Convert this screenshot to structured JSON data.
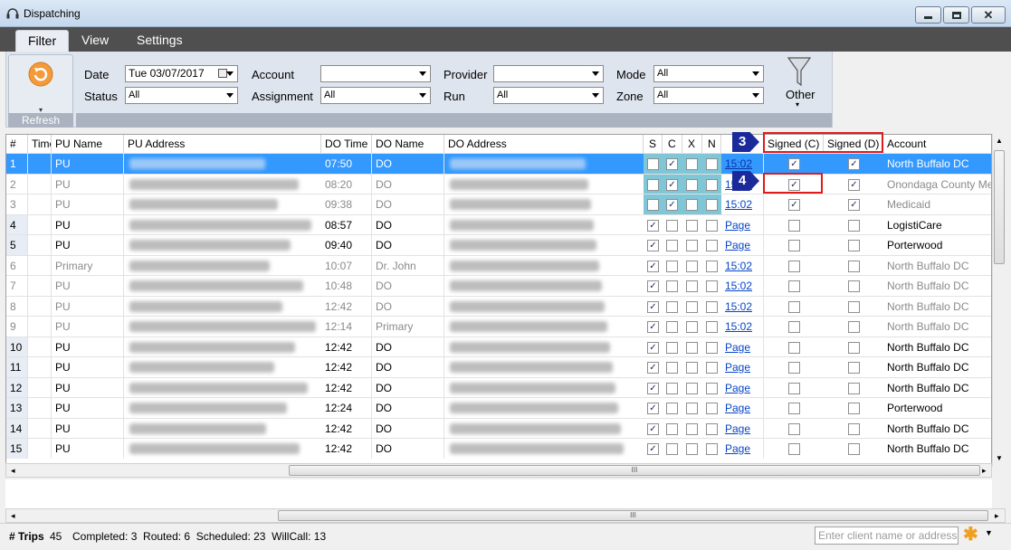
{
  "window": {
    "title": "Dispatching"
  },
  "menu": {
    "tabs": [
      "Filter",
      "View",
      "Settings"
    ]
  },
  "ribbon": {
    "refresh_label": "Refresh",
    "date_label": "Date",
    "date_value": "Tue 03/07/2017",
    "status_label": "Status",
    "status_value": "All",
    "account_label": "Account",
    "account_value": "",
    "assignment_label": "Assignment",
    "assignment_value": "All",
    "provider_label": "Provider",
    "provider_value": "",
    "run_label": "Run",
    "run_value": "All",
    "mode_label": "Mode",
    "mode_value": "All",
    "zone_label": "Zone",
    "zone_value": "All",
    "other_label": "Other"
  },
  "grid": {
    "headers": [
      "#",
      "Time",
      "PU Name",
      "PU Address",
      "DO Time",
      "DO Name",
      "DO Address",
      "S",
      "C",
      "X",
      "N",
      "",
      "Signed (C)",
      "Signed (D)",
      "Account"
    ],
    "rows": [
      {
        "num": "1",
        "pu": "PU",
        "do_time": "07:50",
        "do_name": "DO",
        "s": false,
        "c": true,
        "x": false,
        "n": false,
        "link": "15:02",
        "sc": true,
        "sd": true,
        "account": "North Buffalo DC",
        "muted": false,
        "selected": true,
        "signed_row": true
      },
      {
        "num": "2",
        "pu": "PU",
        "do_time": "08:20",
        "do_name": "DO",
        "s": false,
        "c": true,
        "x": false,
        "n": false,
        "link": "15:02",
        "sc": true,
        "sd": true,
        "account": "Onondaga County Medi",
        "muted": true,
        "selected": false,
        "signed_row": true
      },
      {
        "num": "3",
        "pu": "PU",
        "do_time": "09:38",
        "do_name": "DO",
        "s": false,
        "c": true,
        "x": false,
        "n": false,
        "link": "15:02",
        "sc": true,
        "sd": true,
        "account": "Medicaid",
        "muted": true,
        "selected": false,
        "signed_row": true
      },
      {
        "num": "4",
        "pu": "PU",
        "do_time": "08:57",
        "do_name": "DO",
        "s": true,
        "c": false,
        "x": false,
        "n": false,
        "link": "Page",
        "sc": false,
        "sd": false,
        "account": "LogistiCare",
        "muted": false,
        "selected": false,
        "signed_row": false
      },
      {
        "num": "5",
        "pu": "PU",
        "do_time": "09:40",
        "do_name": "DO",
        "s": true,
        "c": false,
        "x": false,
        "n": false,
        "link": "Page",
        "sc": false,
        "sd": false,
        "account": "Porterwood",
        "muted": false,
        "selected": false,
        "signed_row": false
      },
      {
        "num": "6",
        "pu": "Primary",
        "do_time": "10:07",
        "do_name": "Dr. John",
        "s": true,
        "c": false,
        "x": false,
        "n": false,
        "link": "15:02",
        "sc": false,
        "sd": false,
        "account": "North Buffalo DC",
        "muted": true,
        "selected": false,
        "signed_row": false
      },
      {
        "num": "7",
        "pu": "PU",
        "do_time": "10:48",
        "do_name": "DO",
        "s": true,
        "c": false,
        "x": false,
        "n": false,
        "link": "15:02",
        "sc": false,
        "sd": false,
        "account": "North Buffalo DC",
        "muted": true,
        "selected": false,
        "signed_row": false
      },
      {
        "num": "8",
        "pu": "PU",
        "do_time": "12:42",
        "do_name": "DO",
        "s": true,
        "c": false,
        "x": false,
        "n": false,
        "link": "15:02",
        "sc": false,
        "sd": false,
        "account": "North Buffalo DC",
        "muted": true,
        "selected": false,
        "signed_row": false
      },
      {
        "num": "9",
        "pu": "PU",
        "do_time": "12:14",
        "do_name": "Primary",
        "s": true,
        "c": false,
        "x": false,
        "n": false,
        "link": "15:02",
        "sc": false,
        "sd": false,
        "account": "North Buffalo DC",
        "muted": true,
        "selected": false,
        "signed_row": false
      },
      {
        "num": "10",
        "pu": "PU",
        "do_time": "12:42",
        "do_name": "DO",
        "s": true,
        "c": false,
        "x": false,
        "n": false,
        "link": "Page",
        "sc": false,
        "sd": false,
        "account": "North Buffalo DC",
        "muted": false,
        "selected": false,
        "signed_row": false
      },
      {
        "num": "11",
        "pu": "PU",
        "do_time": "12:42",
        "do_name": "DO",
        "s": true,
        "c": false,
        "x": false,
        "n": false,
        "link": "Page",
        "sc": false,
        "sd": false,
        "account": "North Buffalo DC",
        "muted": false,
        "selected": false,
        "signed_row": false
      },
      {
        "num": "12",
        "pu": "PU",
        "do_time": "12:42",
        "do_name": "DO",
        "s": true,
        "c": false,
        "x": false,
        "n": false,
        "link": "Page",
        "sc": false,
        "sd": false,
        "account": "North Buffalo DC",
        "muted": false,
        "selected": false,
        "signed_row": false
      },
      {
        "num": "13",
        "pu": "PU",
        "do_time": "12:24",
        "do_name": "DO",
        "s": true,
        "c": false,
        "x": false,
        "n": false,
        "link": "Page",
        "sc": false,
        "sd": false,
        "account": "Porterwood",
        "muted": false,
        "selected": false,
        "signed_row": false
      },
      {
        "num": "14",
        "pu": "PU",
        "do_time": "12:42",
        "do_name": "DO",
        "s": true,
        "c": false,
        "x": false,
        "n": false,
        "link": "Page",
        "sc": false,
        "sd": false,
        "account": "North Buffalo DC",
        "muted": false,
        "selected": false,
        "signed_row": false
      },
      {
        "num": "15",
        "pu": "PU",
        "do_time": "12:42",
        "do_name": "DO",
        "s": true,
        "c": false,
        "x": false,
        "n": false,
        "link": "Page",
        "sc": false,
        "sd": false,
        "account": "North Buffalo DC",
        "muted": false,
        "selected": false,
        "signed_row": false
      }
    ]
  },
  "callouts": [
    "3",
    "4"
  ],
  "status": {
    "trips_label": "# Trips",
    "trips_value": "45",
    "summary": "Completed: 3  Routed: 6  Scheduled: 23  WillCall: 13",
    "search_placeholder": "Enter client name or address"
  },
  "colors": {
    "selected_row": "#3399ff",
    "link": "#0645c8",
    "callout": "#1b2a9a",
    "highlight": "#e01b1b"
  }
}
